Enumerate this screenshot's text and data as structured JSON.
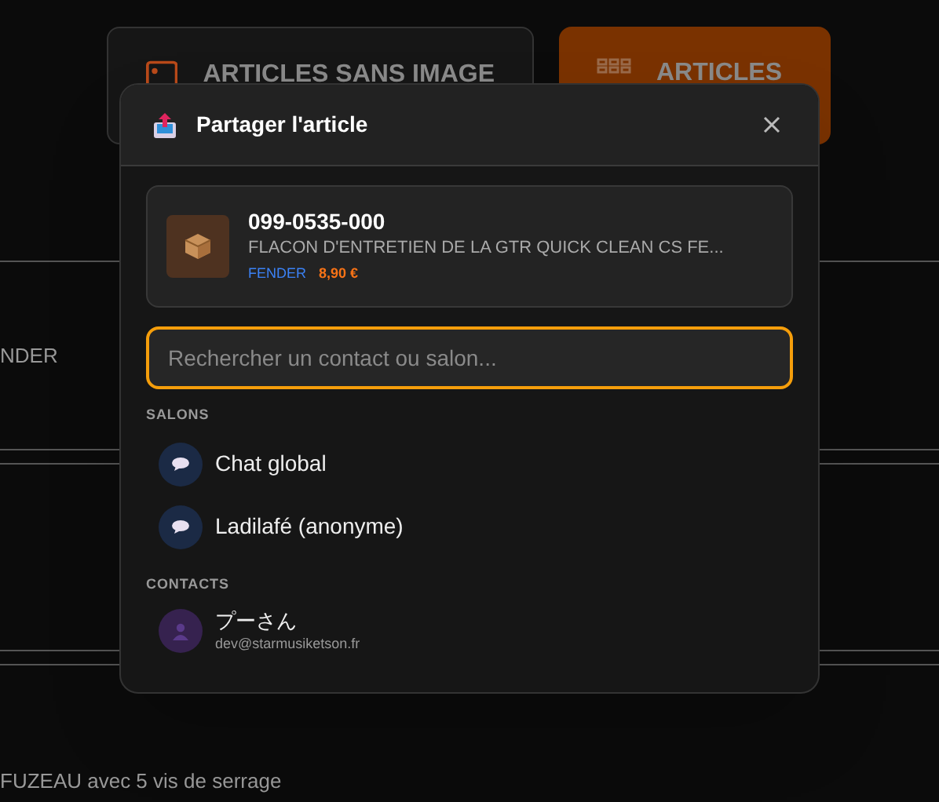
{
  "background": {
    "buttons": [
      {
        "label": "ARTICLES SANS IMAGE",
        "kind": "image",
        "selected": false
      },
      {
        "label": "ARTICLES",
        "kind": "grid",
        "selected": true
      }
    ],
    "brand_cell": "NDER",
    "description_cell": "FUZEAU avec 5 vis de serrage"
  },
  "dialog": {
    "title": "Partager l'article",
    "article": {
      "reference": "099-0535-000",
      "name": "FLACON D'ENTRETIEN DE LA GTR QUICK CLEAN CS FE...",
      "brand": "FENDER",
      "price": "8,90 €"
    },
    "search": {
      "placeholder": "Rechercher un contact ou salon..."
    },
    "sections": [
      {
        "title": "SALONS",
        "items": [
          {
            "kind": "room",
            "name": "Chat global"
          },
          {
            "kind": "room",
            "name": "Ladilafé (anonyme)"
          }
        ]
      },
      {
        "title": "CONTACTS",
        "items": [
          {
            "kind": "contact",
            "name": "プーさん",
            "email": "dev@starmusiketson.fr"
          }
        ]
      }
    ]
  }
}
